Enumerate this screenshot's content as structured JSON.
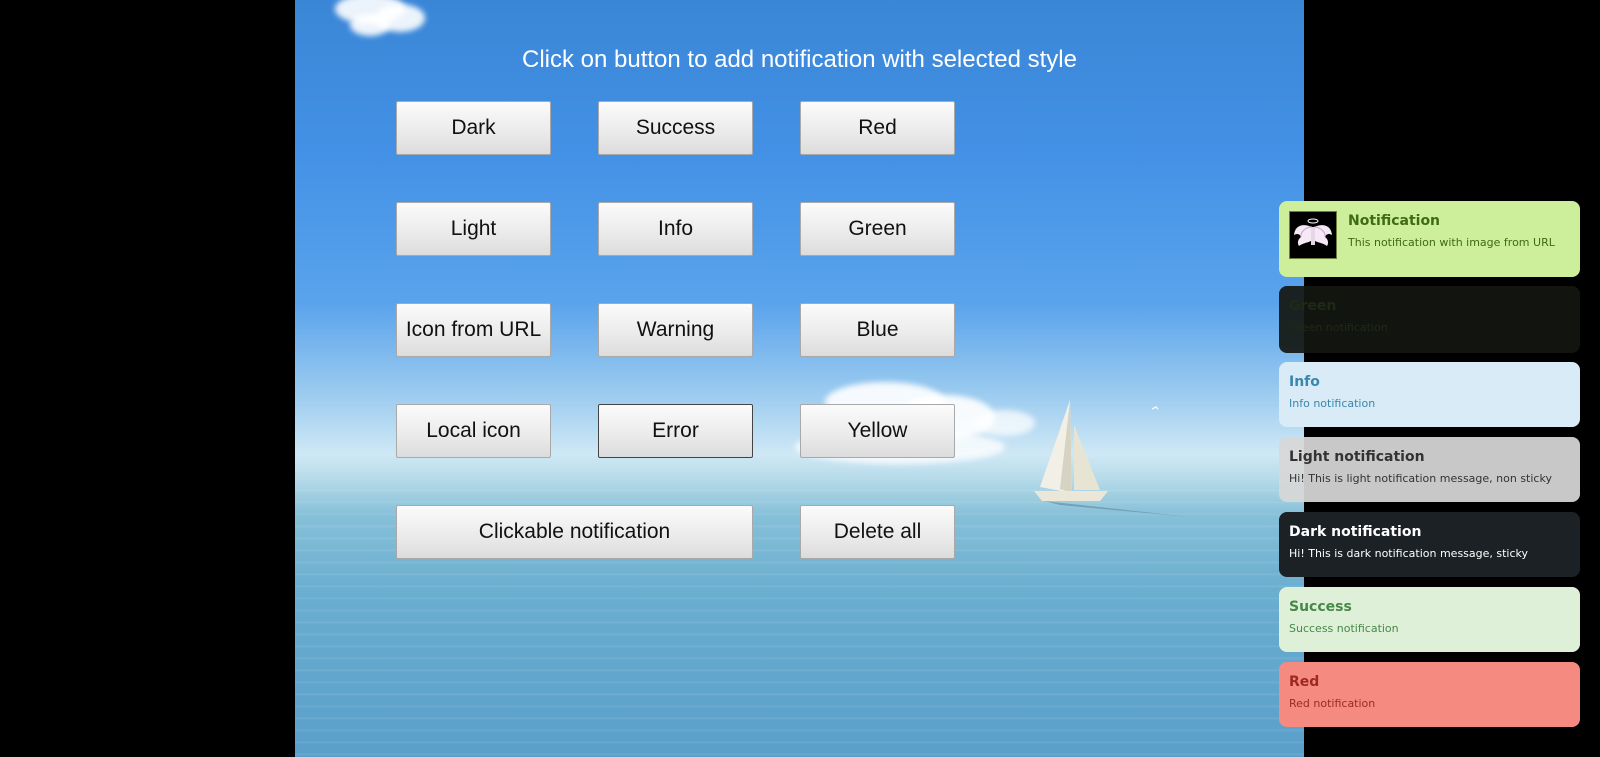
{
  "heading": "Click on button to add notification with selected style",
  "buttons": {
    "dark": "Dark",
    "success": "Success",
    "red": "Red",
    "light": "Light",
    "info": "Info",
    "green": "Green",
    "icon_url": "Icon from URL",
    "warning": "Warning",
    "blue": "Blue",
    "local_icon": "Local icon",
    "error": "Error",
    "yellow": "Yellow",
    "clickable": "Clickable notification",
    "delete_all": "Delete all"
  },
  "notifications": [
    {
      "title": "Notification",
      "message": "This notification with image from URL",
      "style": "image"
    },
    {
      "title": "Green",
      "message": "Green notification",
      "style": "green"
    },
    {
      "title": "Info",
      "message": "Info notification",
      "style": "info"
    },
    {
      "title": "Light notification",
      "message": "Hi! This is light notification message, non sticky",
      "style": "light"
    },
    {
      "title": "Dark notification",
      "message": "Hi! This is dark notification message, sticky",
      "style": "dark"
    },
    {
      "title": "Success",
      "message": "Success notification",
      "style": "success"
    },
    {
      "title": "Red",
      "message": "Red notification",
      "style": "red"
    }
  ],
  "icons": {
    "notification_image": "angel-wings-icon",
    "boat": "sailboat-icon"
  },
  "colors": {
    "sky": "#4391e6",
    "image_notif_bg": "#cdee9a",
    "info_bg": "#d8ebf6",
    "light_bg": "#d7d7d7",
    "dark_bg": "#1b2125",
    "success_bg": "#dff0d8",
    "red_bg": "#f58a80"
  }
}
